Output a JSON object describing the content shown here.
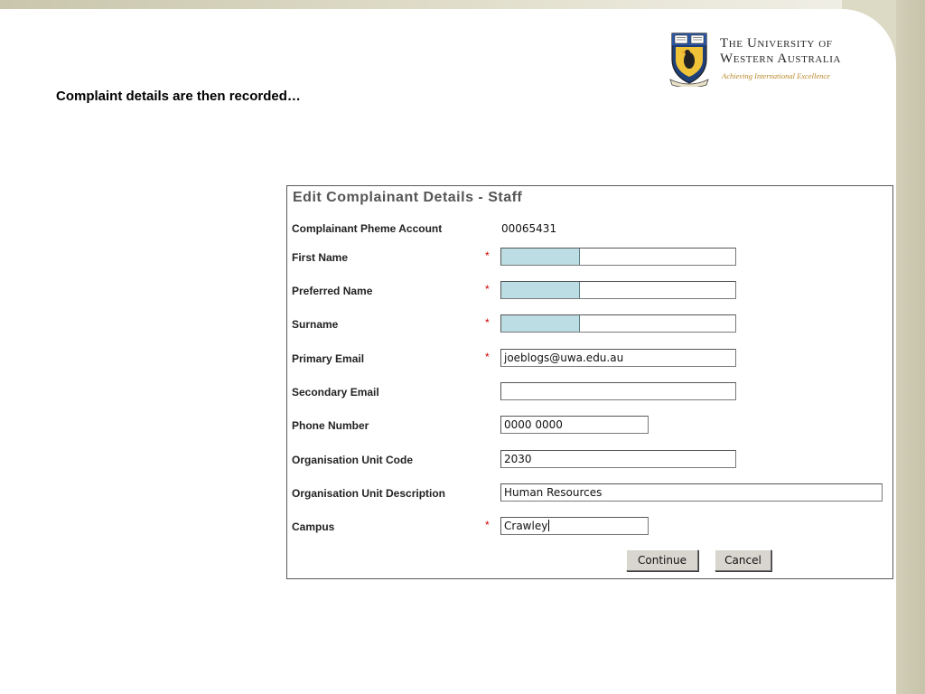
{
  "slide": {
    "heading": "Complaint details are then recorded…"
  },
  "logo": {
    "line1": "The University of",
    "line2": "Western Australia",
    "tagline": "Achieving International Excellence"
  },
  "form": {
    "title": "Edit Complainant Details - Staff",
    "required_marker": "*",
    "account": {
      "label": "Complainant Pheme Account",
      "value": "00065431"
    },
    "fields": {
      "first_name": {
        "label": "First Name",
        "value": "",
        "required": true
      },
      "preferred_name": {
        "label": "Preferred Name",
        "value": "",
        "required": true
      },
      "surname": {
        "label": "Surname",
        "value": "",
        "required": true
      },
      "primary_email": {
        "label": "Primary Email",
        "value": "joeblogs@uwa.edu.au",
        "required": true
      },
      "secondary_email": {
        "label": "Secondary Email",
        "value": "",
        "required": false
      },
      "phone": {
        "label": "Phone Number",
        "value": "0000 0000",
        "required": false
      },
      "org_unit_code": {
        "label": "Organisation Unit Code",
        "value": "2030",
        "required": false
      },
      "org_unit_desc": {
        "label": "Organisation Unit Description",
        "value": "Human Resources",
        "required": false
      },
      "campus": {
        "label": "Campus",
        "value": "Crawley",
        "required": true
      }
    },
    "buttons": {
      "continue": "Continue",
      "cancel": "Cancel"
    }
  },
  "colors": {
    "field_highlight": "#bcdde3",
    "required": "#cc0000",
    "panel_title": "#555555"
  }
}
